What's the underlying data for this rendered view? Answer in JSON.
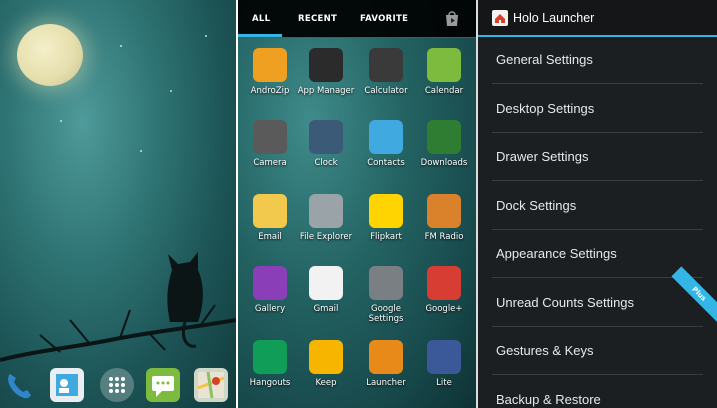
{
  "drawer": {
    "tabs": [
      "ALL",
      "RECENT",
      "FAVORITE"
    ],
    "apps": [
      {
        "label": "AndroZip",
        "icon": "androzip-icon",
        "color": "#f0a020"
      },
      {
        "label": "App Manager",
        "icon": "app-manager-icon",
        "color": "#2b2b2b"
      },
      {
        "label": "Calculator",
        "icon": "calculator-icon",
        "color": "#3a3a3a"
      },
      {
        "label": "Calendar",
        "icon": "calendar-icon",
        "color": "#7cbb3d"
      },
      {
        "label": "Camera",
        "icon": "camera-icon",
        "color": "#5a5a5a"
      },
      {
        "label": "Clock",
        "icon": "clock-icon",
        "color": "#3b5a78"
      },
      {
        "label": "Contacts",
        "icon": "contacts-icon",
        "color": "#3fa9e0"
      },
      {
        "label": "Downloads",
        "icon": "downloads-icon",
        "color": "#2e7d32"
      },
      {
        "label": "Email",
        "icon": "email-icon",
        "color": "#f2c94c"
      },
      {
        "label": "File Explorer",
        "icon": "file-explorer-icon",
        "color": "#9aa3a8"
      },
      {
        "label": "Flipkart",
        "icon": "flipkart-icon",
        "color": "#ffd400"
      },
      {
        "label": "FM Radio",
        "icon": "fm-radio-icon",
        "color": "#d9822b"
      },
      {
        "label": "Gallery",
        "icon": "gallery-icon",
        "color": "#8a3fb8"
      },
      {
        "label": "Gmail",
        "icon": "gmail-icon",
        "color": "#f2f2f2"
      },
      {
        "label": "Google Settings",
        "icon": "google-settings-icon",
        "color": "#7a7f84"
      },
      {
        "label": "Google+",
        "icon": "google-plus-icon",
        "color": "#d73d32"
      },
      {
        "label": "Hangouts",
        "icon": "hangouts-icon",
        "color": "#0f9d58"
      },
      {
        "label": "Keep",
        "icon": "keep-icon",
        "color": "#f7b500"
      },
      {
        "label": "Launcher",
        "icon": "launcher-icon",
        "color": "#e88a1a"
      },
      {
        "label": "Lite",
        "icon": "facebook-lite-icon",
        "color": "#3b5998"
      }
    ]
  },
  "settings": {
    "title": "Holo Launcher",
    "items": [
      "General Settings",
      "Desktop Settings",
      "Drawer Settings",
      "Dock Settings",
      "Appearance Settings",
      "Unread Counts Settings",
      "Gestures & Keys",
      "Backup & Restore"
    ],
    "badge": "Plus",
    "accent": "#33b5e5"
  },
  "home": {
    "dock_icons": [
      "phone-icon",
      "contacts-icon",
      "app-drawer-icon",
      "messaging-icon",
      "maps-icon"
    ]
  }
}
